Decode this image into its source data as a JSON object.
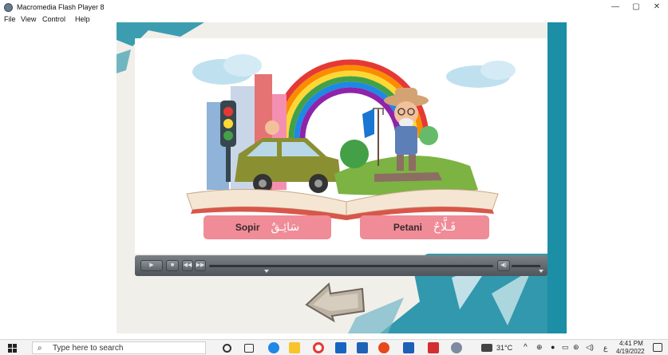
{
  "window": {
    "title": "Macromedia Flash Player 8",
    "minimize": "—",
    "restore": "▢",
    "close": "✕"
  },
  "menu": [
    "File",
    "View",
    "Control",
    "Help"
  ],
  "scene": {
    "word1": {
      "latin": "Sopir",
      "arabic": "سَائِـقٌ"
    },
    "word2": {
      "latin": "Petani",
      "arabic": "فَـلَّاحٌ"
    }
  },
  "player": {
    "play_icon": "play-icon",
    "stop_icon": "stop-icon",
    "rewind_icon": "rewind-icon",
    "forward_icon": "fast-forward-icon",
    "volume_icon": "volume-icon"
  },
  "taskbar": {
    "search_placeholder": "Type here to search",
    "temperature": "31°C",
    "time": "4:41 PM",
    "date": "4/19/2022",
    "language": "ع"
  },
  "colors": {
    "teal": "#1c8ea6",
    "word_box": "#ef8c98"
  }
}
